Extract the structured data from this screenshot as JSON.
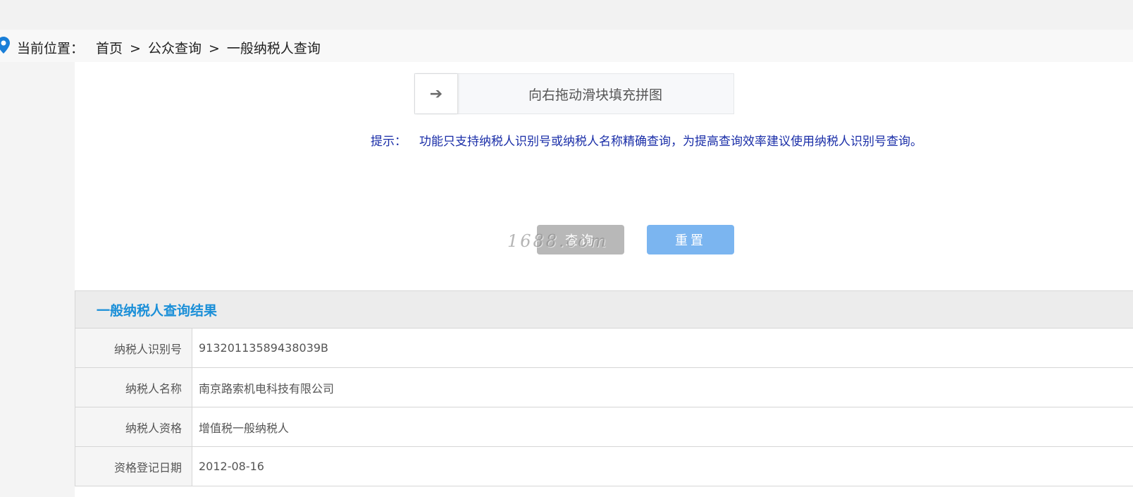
{
  "breadcrumb": {
    "prefix": "当前位置：",
    "items": [
      "首页",
      "公众查询",
      "一般纳税人查询"
    ],
    "separator": ">"
  },
  "slider": {
    "arrow": "➔",
    "text": "向右拖动滑块填充拼图"
  },
  "hint": {
    "label": "提示：",
    "text": "功能只支持纳税人识别号或纳税人名称精确查询，为提高查询效率建议使用纳税人识别号查询。"
  },
  "buttons": {
    "query": "查询",
    "reset": "重置"
  },
  "watermark": "1688.com",
  "result": {
    "title": "一般纳税人查询结果",
    "rows": [
      {
        "label": "纳税人识别号",
        "value": "91320113589438039B"
      },
      {
        "label": "纳税人名称",
        "value": "南京路索机电科技有限公司"
      },
      {
        "label": "纳税人资格",
        "value": "增值税一般纳税人"
      },
      {
        "label": "资格登记日期",
        "value": "2012-08-16"
      }
    ]
  },
  "colors": {
    "accent": "#1a8fd8",
    "hint": "#1a2ea8",
    "query_button": "#b8b8b8",
    "reset_button": "#7bb5f0",
    "pin": "#1a7fd8"
  }
}
